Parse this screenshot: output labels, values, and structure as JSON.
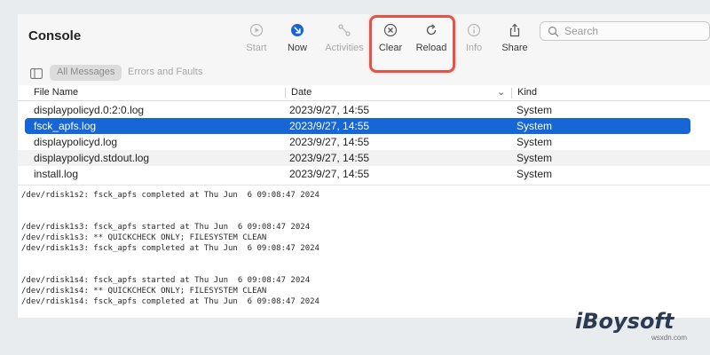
{
  "window": {
    "title": "Console",
    "toolbar": [
      {
        "label": "Start",
        "icon": "play-circle-icon",
        "enabled": false
      },
      {
        "label": "Now",
        "icon": "now-arrow-icon",
        "enabled": true
      },
      {
        "label": "Activities",
        "icon": "activities-icon",
        "enabled": false
      },
      {
        "label": "Clear",
        "icon": "clear-x-icon",
        "enabled": true
      },
      {
        "label": "Reload",
        "icon": "reload-icon",
        "enabled": true
      },
      {
        "label": "Info",
        "icon": "info-icon",
        "enabled": false
      },
      {
        "label": "Share",
        "icon": "share-icon",
        "enabled": true
      }
    ],
    "search": {
      "placeholder": "Search",
      "icon": "search-icon"
    },
    "highlight_color": "#e2544a",
    "accent": "#1766d6"
  },
  "filters": {
    "sidebar_icon": "sidebar-icon",
    "all_messages": "All Messages",
    "errors_and_faults": "Errors and Faults"
  },
  "table": {
    "headers": [
      "File Name",
      "Date",
      "Kind"
    ],
    "rows": [
      {
        "name": "displaypolicyd.0:2:0.log",
        "date": "2023/9/27, 14:55",
        "kind": "System"
      },
      {
        "name": "fsck_apfs.log",
        "date": "2023/9/27, 14:55",
        "kind": "System",
        "selected": true
      },
      {
        "name": "displaypolicyd.log",
        "date": "2023/9/27, 14:55",
        "kind": "System"
      },
      {
        "name": "displaypolicyd.stdout.log",
        "date": "2023/9/27, 14:55",
        "kind": "System"
      },
      {
        "name": "install.log",
        "date": "2023/9/27, 14:55",
        "kind": "System"
      }
    ]
  },
  "log_lines": [
    "/dev/rdisk1s2: fsck_apfs completed at Thu Jun  6 09:08:47 2024",
    "",
    "",
    "/dev/rdisk1s3: fsck_apfs started at Thu Jun  6 09:08:47 2024",
    "/dev/rdisk1s3: ** QUICKCHECK ONLY; FILESYSTEM CLEAN",
    "/dev/rdisk1s3: fsck_apfs completed at Thu Jun  6 09:08:47 2024",
    "",
    "",
    "/dev/rdisk1s4: fsck_apfs started at Thu Jun  6 09:08:47 2024",
    "/dev/rdisk1s4: ** QUICKCHECK ONLY; FILESYSTEM CLEAN",
    "/dev/rdisk1s4: fsck_apfs completed at Thu Jun  6 09:08:47 2024"
  ],
  "watermark": {
    "brand": "iBoysoft",
    "site": "wsxdn.com"
  }
}
